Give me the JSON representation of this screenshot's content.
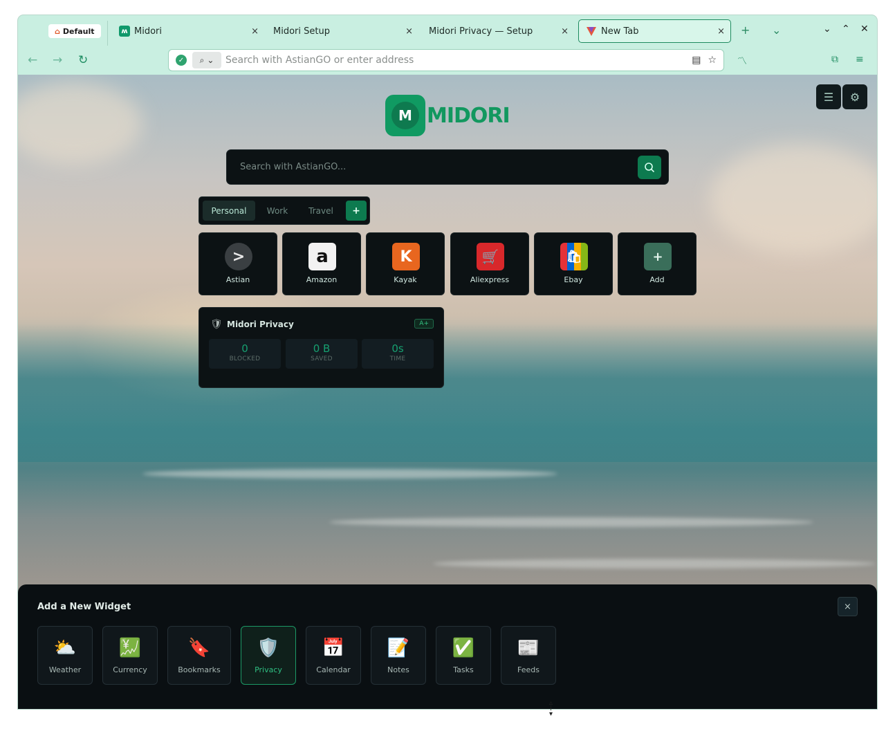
{
  "browser": {
    "container_label": "Default",
    "tabs": [
      {
        "title": "Midori"
      },
      {
        "title": "Midori Setup"
      },
      {
        "title": "Midori Privacy — Setup"
      },
      {
        "title": "New Tab"
      }
    ],
    "tab_close": "×",
    "new_tab": "+",
    "address_placeholder": "Search with AstianGO or enter address"
  },
  "page": {
    "logo_mark": "M",
    "logo_text": "MIDORI",
    "search_placeholder": "Search with AstianGO...",
    "groups": [
      "Personal",
      "Work",
      "Travel"
    ],
    "group_add": "+",
    "tiles": [
      {
        "label": "Astian",
        "glyph": ">"
      },
      {
        "label": "Amazon",
        "glyph": "a"
      },
      {
        "label": "Kayak",
        "glyph": "K"
      },
      {
        "label": "Aliexpress",
        "glyph": "🛒"
      },
      {
        "label": "Ebay",
        "glyph": "🛍"
      },
      {
        "label": "Add",
        "glyph": "+"
      }
    ],
    "privacy": {
      "title": "Midori Privacy",
      "grade": "A+",
      "stats": [
        {
          "value": "0",
          "label": "BLOCKED"
        },
        {
          "value": "0 B",
          "label": "SAVED"
        },
        {
          "value": "0s",
          "label": "TIME"
        }
      ]
    }
  },
  "widget_panel": {
    "title": "Add a New Widget",
    "close": "×",
    "widgets": [
      {
        "label": "Weather",
        "emoji": "⛅"
      },
      {
        "label": "Currency",
        "emoji": "💹"
      },
      {
        "label": "Bookmarks",
        "emoji": "🔖"
      },
      {
        "label": "Privacy",
        "emoji": "🛡️"
      },
      {
        "label": "Calendar",
        "emoji": "📅"
      },
      {
        "label": "Notes",
        "emoji": "📝"
      },
      {
        "label": "Tasks",
        "emoji": "✅"
      },
      {
        "label": "Feeds",
        "emoji": "📰"
      }
    ]
  },
  "colors": {
    "accent": "#0d7a4f",
    "chrome": "#c9efe1",
    "card": "#0c1214"
  }
}
